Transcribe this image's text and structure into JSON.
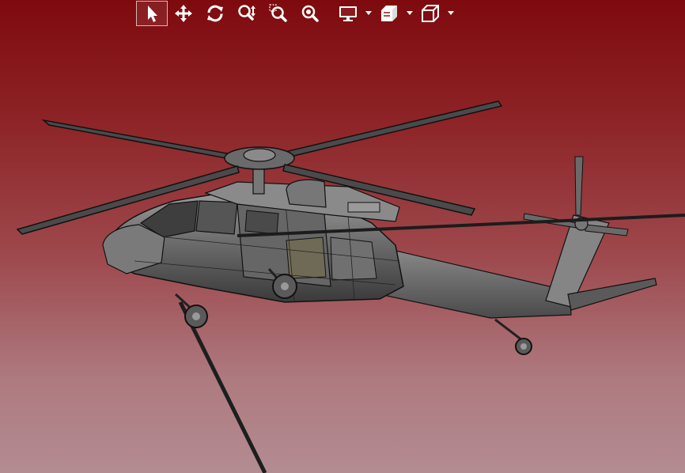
{
  "toolbar": {
    "tools": [
      {
        "id": "select",
        "icon": "cursor-arrow-icon",
        "active": true
      },
      {
        "id": "pan",
        "icon": "move-arrows-icon"
      },
      {
        "id": "rotate",
        "icon": "rotate-icon"
      },
      {
        "id": "zoom-dynamic",
        "icon": "zoom-updown-icon"
      },
      {
        "id": "zoom-window",
        "icon": "zoom-window-icon"
      },
      {
        "id": "zoom-fit",
        "icon": "zoom-fit-icon"
      },
      {
        "id": "display-mode",
        "icon": "monitor-icon",
        "dropdown": true
      },
      {
        "id": "render-style",
        "icon": "shaded-box-icon",
        "dropdown": true
      },
      {
        "id": "standard-views",
        "icon": "cube-view-icon",
        "dropdown": true
      }
    ]
  },
  "scene": {
    "model": "helicopter",
    "colors": {
      "background_top": "#7e0a0e",
      "background_bottom": "#b38c92",
      "body": "#6f6f6f",
      "edges": "#141414",
      "toolbar_icon": "#ffffff"
    }
  }
}
